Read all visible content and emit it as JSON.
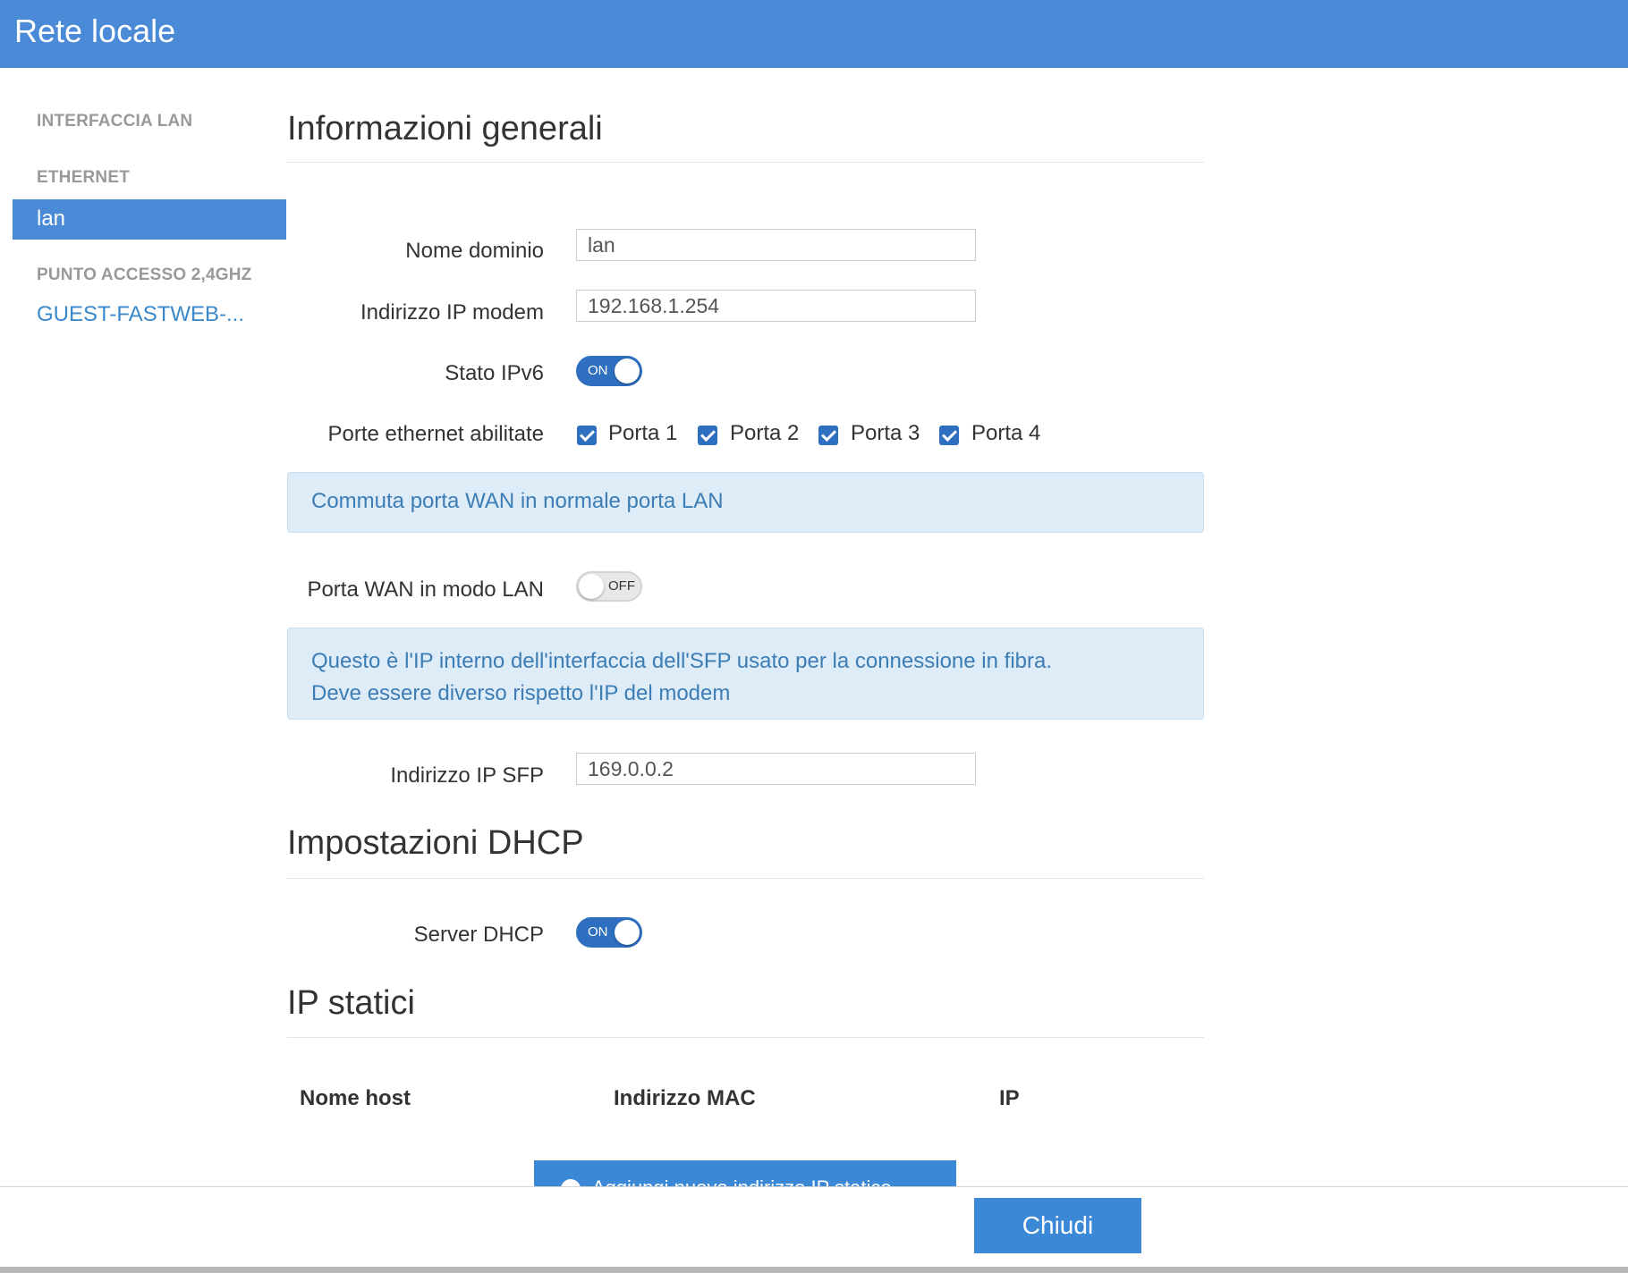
{
  "header": {
    "title": "Rete locale"
  },
  "sidebar": {
    "section_lan": "INTERFACCIA LAN",
    "section_ethernet": "ETHERNET",
    "active_item": "lan",
    "section_ap": "PUNTO ACCESSO 2,4GHZ",
    "ap_item": "GUEST-FASTWEB-..."
  },
  "general": {
    "title": "Informazioni generali",
    "domain_label": "Nome dominio",
    "domain_value": "lan",
    "modem_ip_label": "Indirizzo IP modem",
    "modem_ip_value": "192.168.1.254",
    "ipv6_label": "Stato IPv6",
    "ipv6_state": "ON",
    "ports_label": "Porte ethernet abilitate",
    "ports": [
      {
        "label": "Porta 1",
        "checked": true
      },
      {
        "label": "Porta 2",
        "checked": true
      },
      {
        "label": "Porta 3",
        "checked": true
      },
      {
        "label": "Porta 4",
        "checked": true
      }
    ],
    "wan_info": "Commuta porta WAN in normale porta LAN",
    "wan_lan_label": "Porta WAN in modo LAN",
    "wan_lan_state": "OFF",
    "sfp_info_line1": "Questo è l'IP interno dell'interfaccia dell'SFP usato per la connessione in fibra.",
    "sfp_info_line2": "Deve essere diverso rispetto l'IP del modem",
    "sfp_ip_label": "Indirizzo IP SFP",
    "sfp_ip_value": "169.0.0.2"
  },
  "dhcp": {
    "title": "Impostazioni DHCP",
    "server_label": "Server DHCP",
    "server_state": "ON"
  },
  "static_ip": {
    "title": "IP statici",
    "columns": [
      "Nome host",
      "Indirizzo MAC",
      "IP"
    ],
    "add_button": "Aggiungi nuovo indirizzo IP statico"
  },
  "footer": {
    "close_label": "Chiudi"
  },
  "colors": {
    "accent": "#4a8ad6",
    "toggle_on": "#2e6fbf",
    "info_bg": "#deecf7",
    "info_text": "#3c7db5"
  }
}
